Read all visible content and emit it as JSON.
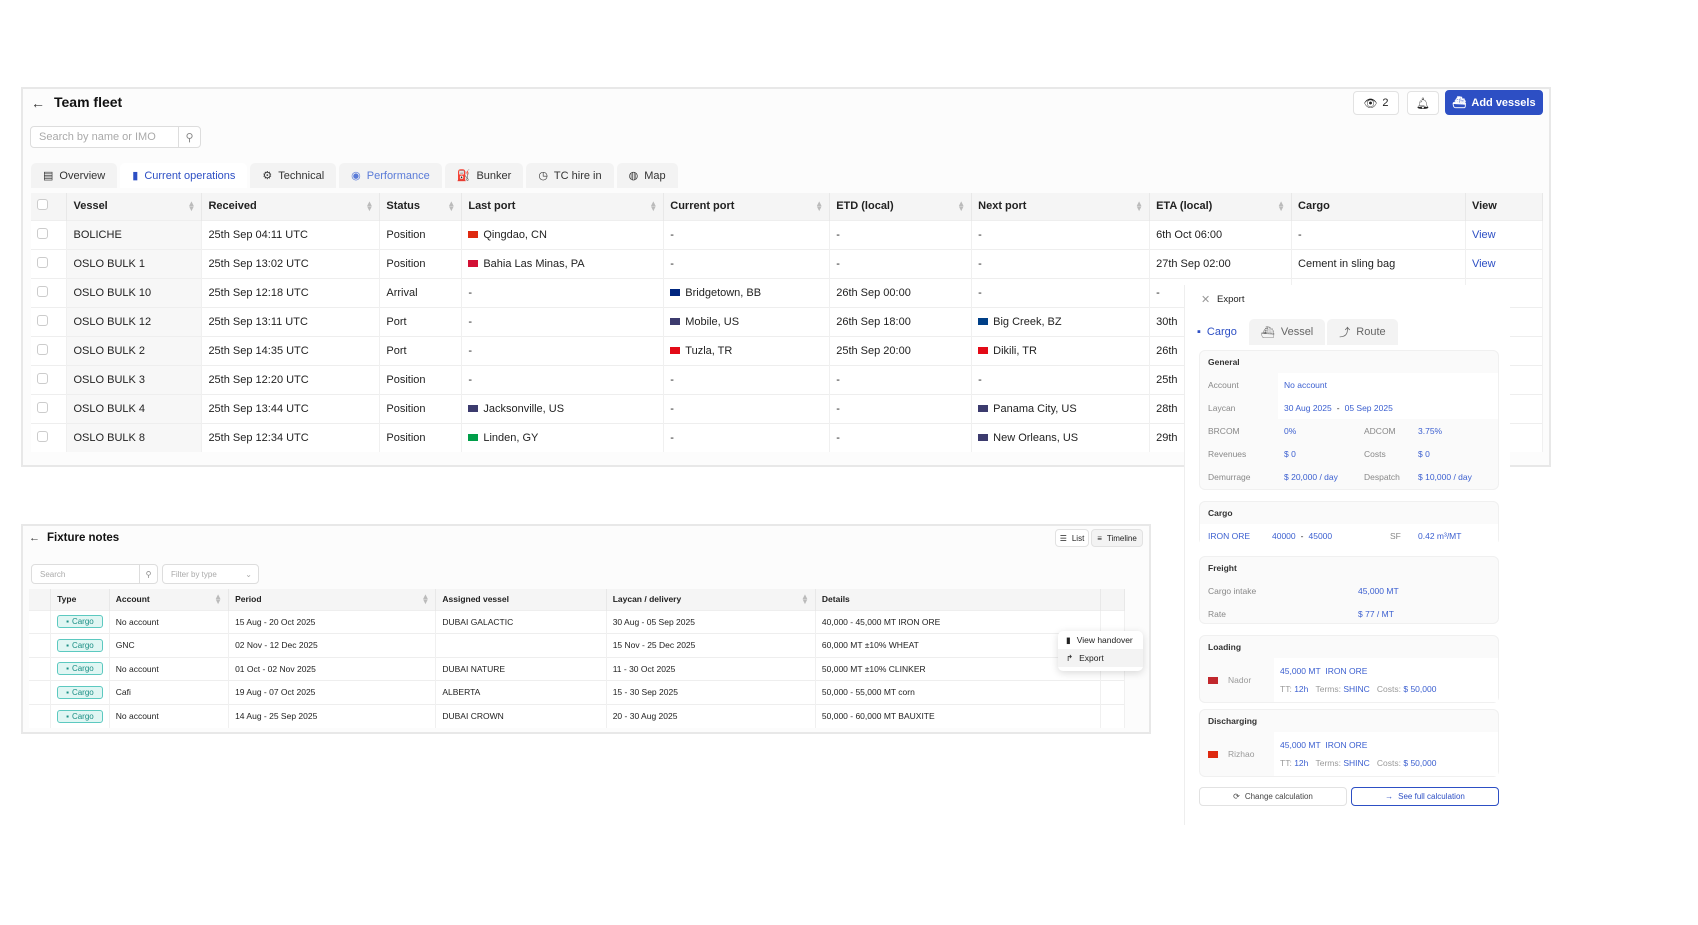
{
  "fleet": {
    "title": "Team fleet",
    "search_placeholder": "Search by name or IMO",
    "watchers": "2",
    "add_label": "Add vessels",
    "tabs": [
      "Overview",
      "Current operations",
      "Technical",
      "Performance",
      "Bunker",
      "TC hire in",
      "Map"
    ],
    "columns": [
      "Vessel",
      "Received",
      "Status",
      "Last port",
      "Current port",
      "ETD (local)",
      "Next port",
      "ETA (local)",
      "Cargo",
      "View"
    ],
    "rows": [
      [
        "BOLICHE",
        "25th Sep 04:11 UTC",
        "Position",
        "Qingdao, CN",
        "-",
        "-",
        "-",
        "6th Oct 06:00",
        "-",
        "View"
      ],
      [
        "OSLO BULK 1",
        "25th Sep 13:02 UTC",
        "Position",
        "Bahia Las Minas, PA",
        "-",
        "-",
        "-",
        "27th Sep 02:00",
        "Cement in sling bag",
        "View"
      ],
      [
        "OSLO BULK 10",
        "25th Sep 12:18 UTC",
        "Arrival",
        "-",
        "Bridgetown, BB",
        "26th Sep 00:00",
        "-",
        "-",
        "",
        ""
      ],
      [
        "OSLO BULK 12",
        "25th Sep 13:11 UTC",
        "Port",
        "-",
        "Mobile, US",
        "26th Sep 18:00",
        "Big Creek, BZ",
        "30th",
        "",
        ""
      ],
      [
        "OSLO BULK 2",
        "25th Sep 14:35 UTC",
        "Port",
        "-",
        "Tuzla, TR",
        "25th Sep 20:00",
        "Dikili, TR",
        "26th",
        "",
        ""
      ],
      [
        "OSLO BULK 3",
        "25th Sep 12:20 UTC",
        "Position",
        "-",
        "-",
        "-",
        "-",
        "25th",
        "",
        ""
      ],
      [
        "OSLO BULK 4",
        "25th Sep 13:44 UTC",
        "Position",
        "Jacksonville, US",
        "-",
        "-",
        "Panama City, US",
        "28th",
        "",
        ""
      ],
      [
        "OSLO BULK 8",
        "25th Sep 12:34 UTC",
        "Position",
        "Linden, GY",
        "-",
        "-",
        "New Orleans, US",
        "29th",
        "",
        ""
      ]
    ],
    "flags": {
      "Qingdao, CN": "#de2910",
      "Bahia Las Minas, PA": "#d21034",
      "Bridgetown, BB": "#00267f",
      "Mobile, US": "#3c3b6e",
      "Tuzla, TR": "#e30a17",
      "Big Creek, BZ": "#003f87",
      "Dikili, TR": "#e30a17",
      "Jacksonville, US": "#3c3b6e",
      "Panama City, US": "#3c3b6e",
      "Linden, GY": "#009e49",
      "New Orleans, US": "#3c3b6e"
    }
  },
  "fixture": {
    "title": "Fixture notes",
    "list_label": "List",
    "timeline_label": "Timeline",
    "search_placeholder": "Search",
    "filter_placeholder": "Filter by type",
    "columns": [
      "Type",
      "Account",
      "Period",
      "Assigned vessel",
      "Laycan / delivery",
      "Details"
    ],
    "rows": [
      [
        "Cargo",
        "No account",
        "15 Aug - 20 Oct 2025",
        "DUBAI GALACTIC",
        "30 Aug - 05 Sep 2025",
        "40,000 - 45,000 MT IRON ORE"
      ],
      [
        "Cargo",
        "GNC",
        "02 Nov - 12 Dec 2025",
        "",
        "15 Nov - 25 Dec 2025",
        "60,000 MT ±10% WHEAT"
      ],
      [
        "Cargo",
        "No account",
        "01 Oct - 02 Nov 2025",
        "DUBAI NATURE",
        "11 - 30 Oct 2025",
        "50,000 MT ±10% CLINKER"
      ],
      [
        "Cargo",
        "Cafi",
        "19 Aug - 07 Oct 2025",
        "ALBERTA",
        "15 - 30 Sep 2025",
        "50,000 - 55,000 MT corn"
      ],
      [
        "Cargo",
        "No account",
        "14 Aug - 25 Sep 2025",
        "DUBAI CROWN",
        "20 - 30 Aug 2025",
        "50,000 - 60,000 MT BAUXITE"
      ]
    ],
    "menu": [
      "View handover",
      "Export"
    ]
  },
  "export": {
    "title": "Export",
    "tabs": [
      "Cargo",
      "Vessel",
      "Route"
    ],
    "general": {
      "title": "General",
      "account_label": "Account",
      "account": "No account",
      "laycan_label": "Laycan",
      "laycan_from": "30 Aug 2025",
      "laycan_to": "05 Sep 2025",
      "brcom_label": "BRCOM",
      "brcom": "0%",
      "adcom_label": "ADCOM",
      "adcom": "3.75%",
      "revenues_label": "Revenues",
      "revenues": "$ 0",
      "costs_label": "Costs",
      "costs": "$ 0",
      "demurrage_label": "Demurrage",
      "demurrage": "$ 20,000 / day",
      "despatch_label": "Despatch",
      "despatch": "$ 10,000 / day"
    },
    "cargo": {
      "title": "Cargo",
      "name": "IRON ORE",
      "qty_from": "40000",
      "qty_to": "45000",
      "sf_label": "SF",
      "sf": "0.42 m³/MT"
    },
    "freight": {
      "title": "Freight",
      "intake_label": "Cargo intake",
      "intake": "45,000 MT",
      "rate_label": "Rate",
      "rate": "$ 77 / MT"
    },
    "loading": {
      "title": "Loading",
      "port": "Nador",
      "qty": "45,000 MT",
      "cargo": "IRON ORE",
      "tt_label": "TT:",
      "tt": "12h",
      "terms_label": "Terms:",
      "terms": "SHINC",
      "costs_label": "Costs:",
      "costs": "$ 50,000"
    },
    "discharging": {
      "title": "Discharging",
      "port": "Rizhao",
      "qty": "45,000 MT",
      "cargo": "IRON ORE",
      "tt_label": "TT:",
      "tt": "12h",
      "terms_label": "Terms:",
      "terms": "SHINC",
      "costs_label": "Costs:",
      "costs": "$ 50,000"
    },
    "change_label": "Change calculation",
    "full_label": "See full calculation"
  },
  "colors": {
    "accent": "#2d4fc4",
    "cargo_chip": "#1a8e84"
  }
}
